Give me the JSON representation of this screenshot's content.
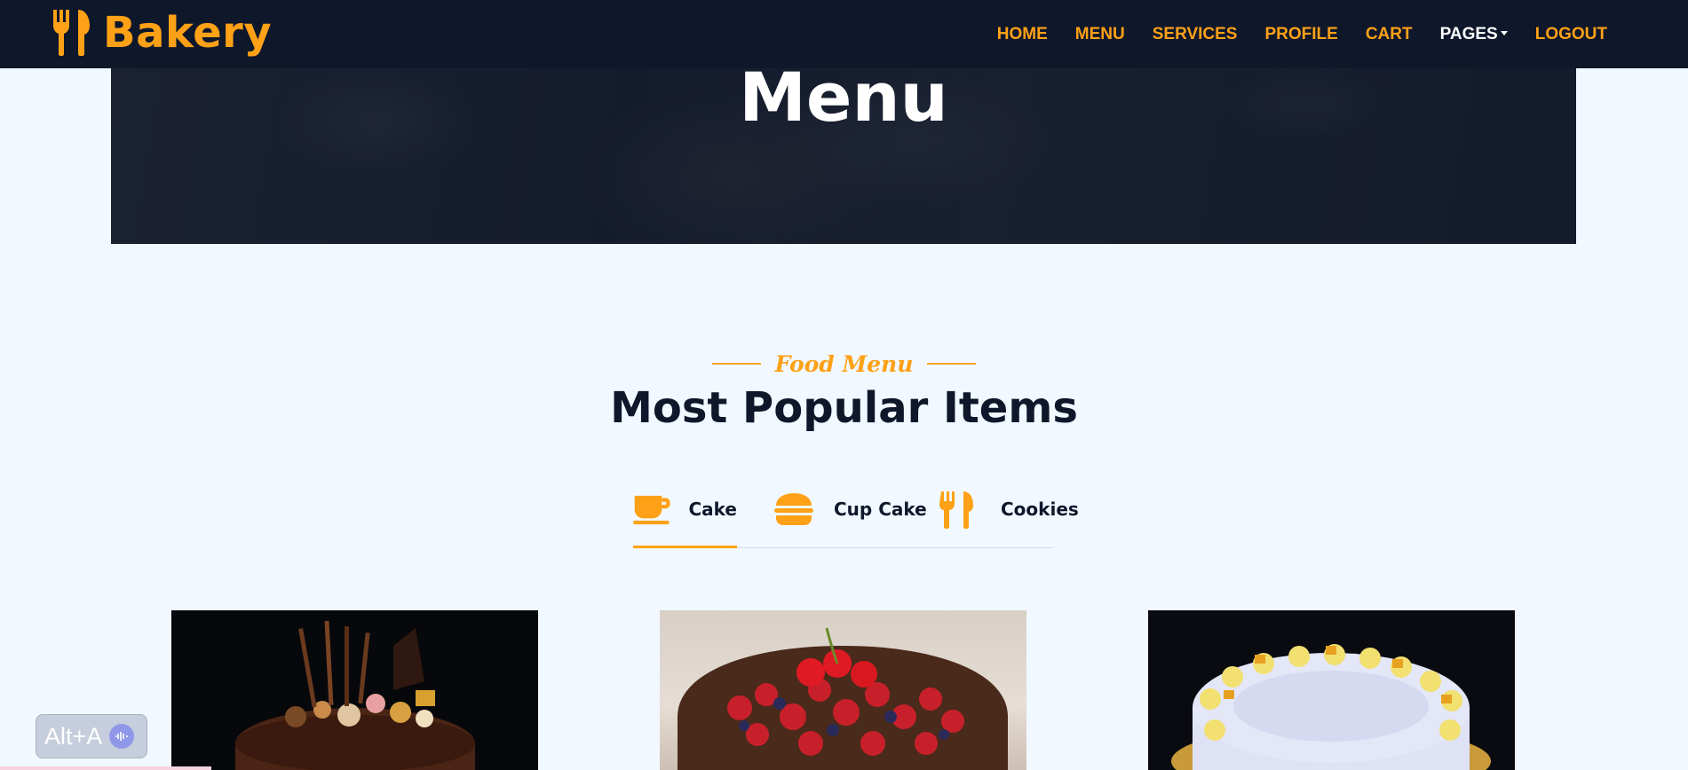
{
  "brand": {
    "name": "Bakery"
  },
  "nav": {
    "items": [
      {
        "label": "HOME"
      },
      {
        "label": "MENU"
      },
      {
        "label": "SERVICES"
      },
      {
        "label": "PROFILE"
      },
      {
        "label": "CART"
      },
      {
        "label": "PAGES"
      },
      {
        "label": "LOGOUT"
      }
    ]
  },
  "hero": {
    "title": "Menu"
  },
  "section": {
    "subtitle": "Food Menu",
    "title": "Most Popular Items"
  },
  "tabs": [
    {
      "label": "Cake",
      "icon": "coffee-cup-icon",
      "active": true
    },
    {
      "label": "Cup Cake",
      "icon": "hamburger-icon",
      "active": false
    },
    {
      "label": "Cookies",
      "icon": "utensils-icon",
      "active": false
    }
  ],
  "products": [
    {
      "name": "chocolate-cake"
    },
    {
      "name": "berry-cake"
    },
    {
      "name": "cream-cake"
    }
  ],
  "overlay": {
    "shortcut": "Alt+A"
  },
  "colors": {
    "accent": "#fea116",
    "dark": "#0f172b",
    "background": "#f1f8ff"
  }
}
